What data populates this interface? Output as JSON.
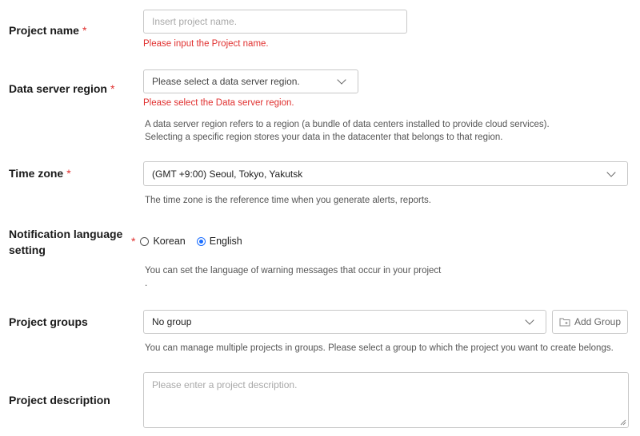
{
  "project_name": {
    "label": "Project name",
    "required": "*",
    "placeholder": "Insert project name.",
    "error": "Please input the Project name."
  },
  "data_server_region": {
    "label": "Data server region",
    "required": "*",
    "placeholder": "Please select a data server region.",
    "error": "Please select the Data server region.",
    "help_line1": "A data server region refers to a region (a bundle of data centers installed to provide cloud services).",
    "help_line2": "Selecting a specific region stores your data in the datacenter that belongs to that region."
  },
  "time_zone": {
    "label": "Time zone",
    "required": "*",
    "value": "(GMT +9:00) Seoul, Tokyo, Yakutsk",
    "help": "The time zone is the reference time when you generate alerts, reports."
  },
  "notification_language": {
    "label_line1": "Notification language",
    "label_line2": "setting",
    "required": "*",
    "options": [
      "Korean",
      "English"
    ],
    "selected": "English",
    "help_line1": "You can set the language of warning messages that occur in your project",
    "help_line2": "."
  },
  "project_groups": {
    "label": "Project groups",
    "value": "No group",
    "add_button": "Add Group",
    "help": "You can manage multiple projects in groups. Please select a group to which the project you want to create belongs."
  },
  "project_description": {
    "label": "Project description",
    "placeholder": "Please enter a project description."
  },
  "colors": {
    "error": "#e0302f",
    "accent": "#1a6dff",
    "border": "#c8c8c8"
  }
}
